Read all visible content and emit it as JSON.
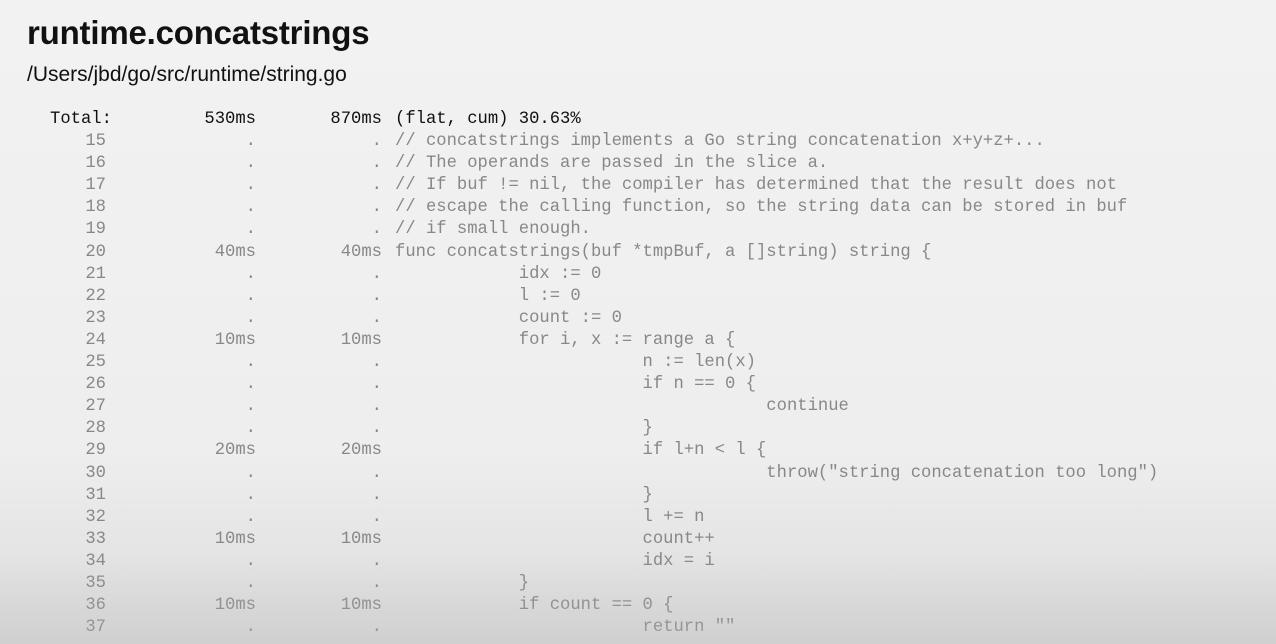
{
  "header": {
    "title": "runtime.concatstrings",
    "file_path": "/Users/jbd/go/src/runtime/string.go"
  },
  "total": {
    "label": "Total:",
    "flat": "530ms",
    "cum": "870ms",
    "summary": "(flat, cum) 30.63%"
  },
  "lines": [
    {
      "n": "15",
      "flat": ".",
      "cum": ".",
      "code": "// concatstrings implements a Go string concatenation x+y+z+..."
    },
    {
      "n": "16",
      "flat": ".",
      "cum": ".",
      "code": "// The operands are passed in the slice a."
    },
    {
      "n": "17",
      "flat": ".",
      "cum": ".",
      "code": "// If buf != nil, the compiler has determined that the result does not"
    },
    {
      "n": "18",
      "flat": ".",
      "cum": ".",
      "code": "// escape the calling function, so the string data can be stored in buf"
    },
    {
      "n": "19",
      "flat": ".",
      "cum": ".",
      "code": "// if small enough."
    },
    {
      "n": "20",
      "flat": "40ms",
      "cum": "40ms",
      "code": "func concatstrings(buf *tmpBuf, a []string) string {"
    },
    {
      "n": "21",
      "flat": ".",
      "cum": ".",
      "code": "            idx := 0"
    },
    {
      "n": "22",
      "flat": ".",
      "cum": ".",
      "code": "            l := 0"
    },
    {
      "n": "23",
      "flat": ".",
      "cum": ".",
      "code": "            count := 0"
    },
    {
      "n": "24",
      "flat": "10ms",
      "cum": "10ms",
      "code": "            for i, x := range a {"
    },
    {
      "n": "25",
      "flat": ".",
      "cum": ".",
      "code": "                        n := len(x)"
    },
    {
      "n": "26",
      "flat": ".",
      "cum": ".",
      "code": "                        if n == 0 {"
    },
    {
      "n": "27",
      "flat": ".",
      "cum": ".",
      "code": "                                    continue"
    },
    {
      "n": "28",
      "flat": ".",
      "cum": ".",
      "code": "                        }"
    },
    {
      "n": "29",
      "flat": "20ms",
      "cum": "20ms",
      "code": "                        if l+n < l {"
    },
    {
      "n": "30",
      "flat": ".",
      "cum": ".",
      "code": "                                    throw(\"string concatenation too long\")"
    },
    {
      "n": "31",
      "flat": ".",
      "cum": ".",
      "code": "                        }"
    },
    {
      "n": "32",
      "flat": ".",
      "cum": ".",
      "code": "                        l += n"
    },
    {
      "n": "33",
      "flat": "10ms",
      "cum": "10ms",
      "code": "                        count++"
    },
    {
      "n": "34",
      "flat": ".",
      "cum": ".",
      "code": "                        idx = i"
    },
    {
      "n": "35",
      "flat": ".",
      "cum": ".",
      "code": "            }"
    },
    {
      "n": "36",
      "flat": "10ms",
      "cum": "10ms",
      "code": "            if count == 0 {"
    },
    {
      "n": "37",
      "flat": ".",
      "cum": ".",
      "code": "                        return \"\""
    }
  ]
}
